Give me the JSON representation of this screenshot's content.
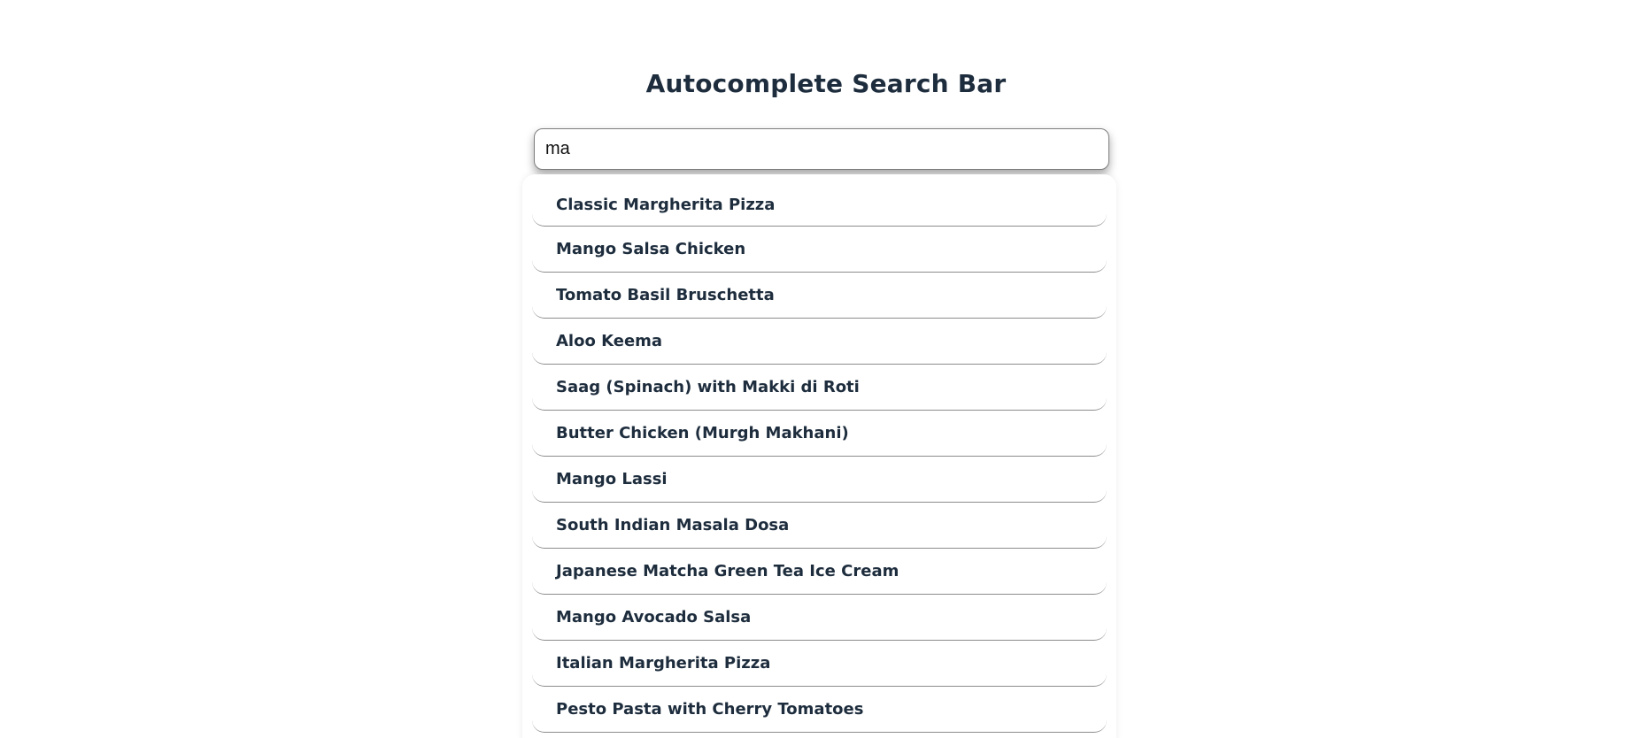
{
  "page": {
    "title": "Autocomplete Search Bar"
  },
  "search": {
    "value": "ma",
    "placeholder": ""
  },
  "suggestions": [
    "Classic Margherita Pizza",
    "Mango Salsa Chicken",
    "Tomato Basil Bruschetta",
    "Aloo Keema",
    "Saag (Spinach) with Makki di Roti",
    "Butter Chicken (Murgh Makhani)",
    "Mango Lassi",
    "South Indian Masala Dosa",
    "Japanese Matcha Green Tea Ice Cream",
    "Mango Avocado Salsa",
    "Italian Margherita Pizza",
    "Pesto Pasta with Cherry Tomatoes"
  ],
  "colors": {
    "text": "#1e2d3d",
    "background": "#ffffff",
    "divider": "#8c8c8c"
  }
}
